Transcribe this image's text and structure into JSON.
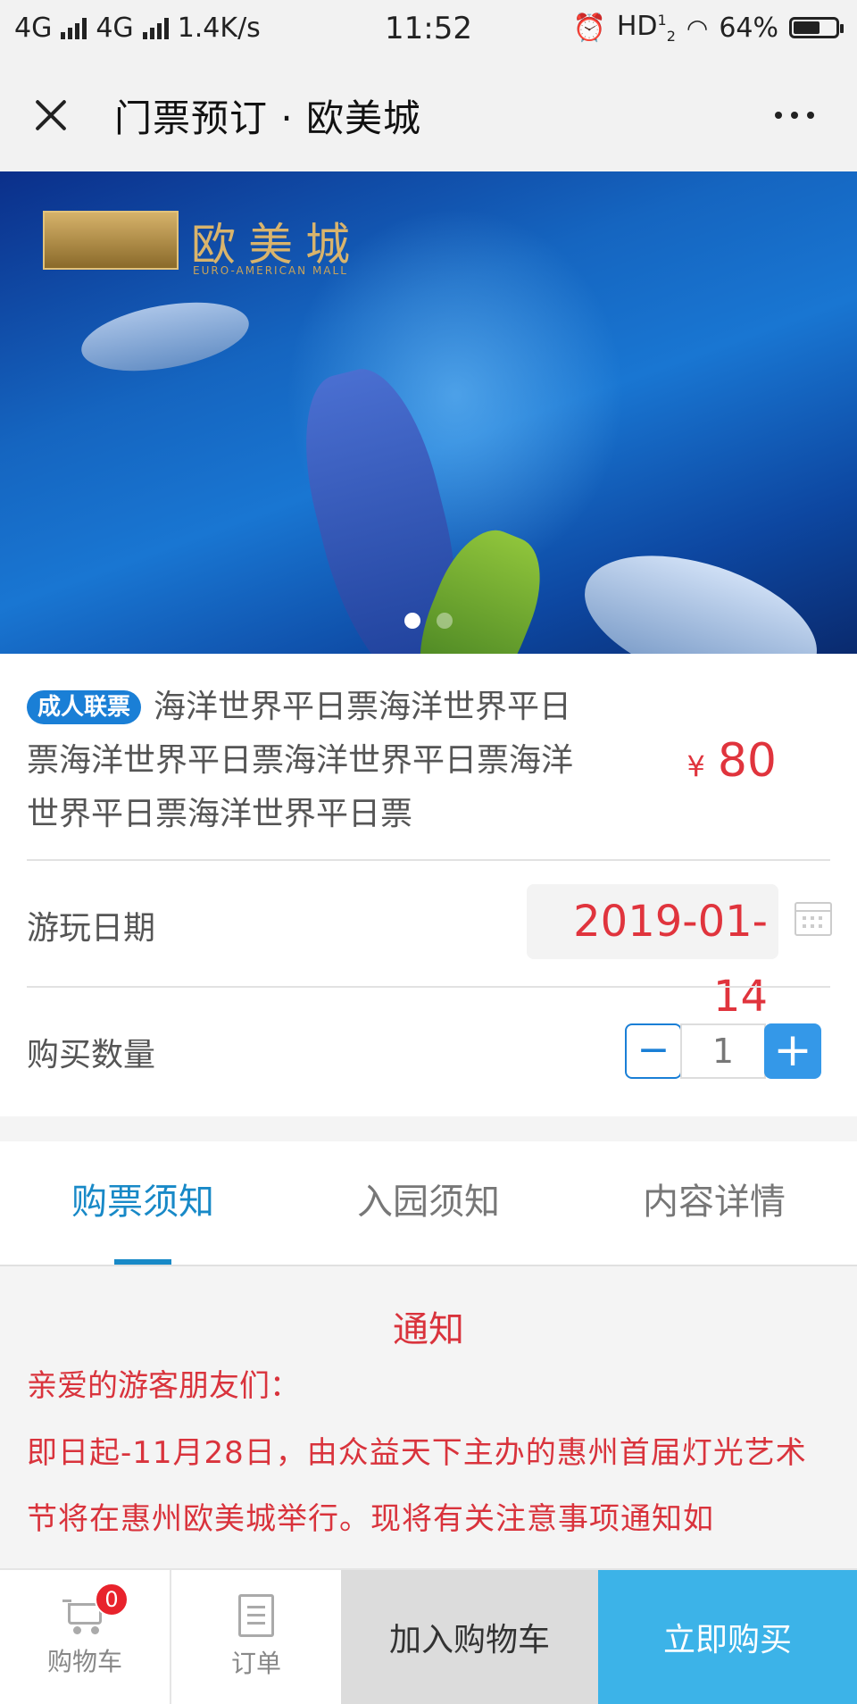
{
  "status": {
    "network1": "4G",
    "network2": "4G",
    "speed": "1.4K/s",
    "time": "11:52",
    "hd": "HD",
    "hd_sup": "1",
    "hd_sub": "2",
    "battery": "64%",
    "battery_level": 0.64
  },
  "nav": {
    "title": "门票预订 · 欧美城"
  },
  "banner": {
    "logo_text": "欧美城",
    "logo_sub": "EURO-AMERICAN MALL",
    "slide_count": 2,
    "active_slide": 1
  },
  "product": {
    "badge": "成人联票",
    "name": "海洋世界平日票海洋世界平日票海洋世界平日票海洋世界平日票海洋世界平日票海洋世界平日票",
    "currency": "¥",
    "price": "80"
  },
  "date_row": {
    "label": "游玩日期",
    "value": "2019-01-14"
  },
  "quantity_row": {
    "label": "购买数量",
    "minus": "−",
    "value": "1",
    "plus": "+"
  },
  "tabs": [
    {
      "label": "购票须知",
      "active": true
    },
    {
      "label": "入园须知",
      "active": false
    },
    {
      "label": "内容详情",
      "active": false
    }
  ],
  "notice": {
    "title": "通知",
    "greeting": "亲爱的游客朋友们：",
    "body": "即日起-11月28日，由众益天下主办的惠州首届灯光艺术节将在惠州欧美城举行。现将有关注意事项通知如"
  },
  "bottom_bar": {
    "cart_label": "购物车",
    "cart_count": "0",
    "orders_label": "订单",
    "add_to_cart": "加入购物车",
    "buy_now": "立即购买"
  },
  "colors": {
    "accent_blue": "#1889c7",
    "price_red": "#e0343d",
    "buy_button": "#3cb3e8"
  }
}
